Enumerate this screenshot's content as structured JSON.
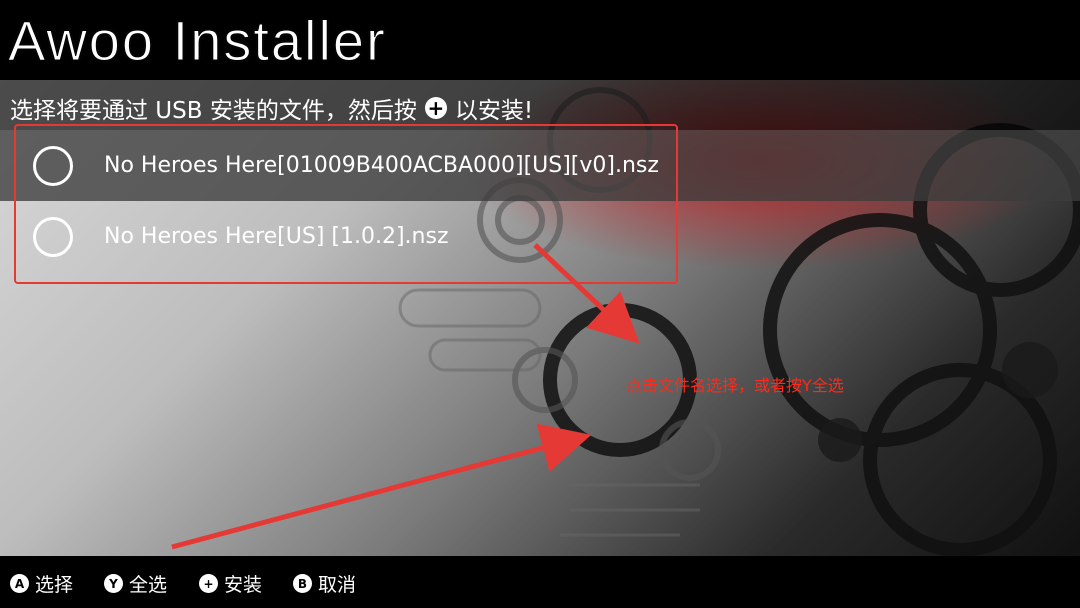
{
  "app": {
    "title": "Awoo Installer"
  },
  "instruction": {
    "before": "选择将要通过 USB 安装的文件，然后按",
    "after": "以安装!",
    "plus_icon": "plus-circle-icon"
  },
  "files": [
    {
      "name": "No Heroes Here[01009B400ACBA000][US][v0].nsz",
      "selected": false
    },
    {
      "name": "No Heroes Here[US] [1.0.2].nsz",
      "selected": false
    }
  ],
  "annotation": {
    "text": "点击文件名选择，或者按Y全选",
    "color": "#ff2a1a"
  },
  "footer": {
    "hints": [
      {
        "glyph": "A",
        "label": "选择"
      },
      {
        "glyph": "Y",
        "label": "全选"
      },
      {
        "glyph": "+",
        "label": "安装"
      },
      {
        "glyph": "B",
        "label": "取消"
      }
    ]
  },
  "colors": {
    "accent_red": "#e53935",
    "background": "#000000",
    "text": "#ffffff"
  }
}
